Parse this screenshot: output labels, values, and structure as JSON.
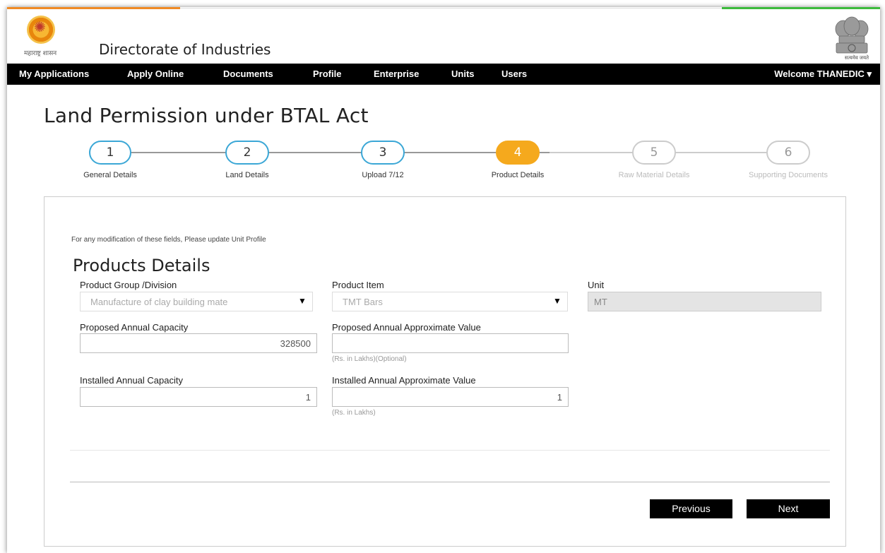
{
  "header": {
    "logo_left_text": "महाराष्ट्र शासन",
    "title": "Directorate of Industries",
    "emblem_text": "सत्यमेव जयते"
  },
  "nav": {
    "items": [
      {
        "label": "My Applications"
      },
      {
        "label": "Apply Online"
      },
      {
        "label": "Documents"
      },
      {
        "label": "Profile"
      },
      {
        "label": "Enterprise"
      },
      {
        "label": "Units"
      },
      {
        "label": "Users"
      }
    ],
    "welcome": "Welcome THANEDIC ▾"
  },
  "page": {
    "title": "Land Permission under BTAL Act"
  },
  "steps": [
    {
      "number": "1",
      "label": "General Details",
      "state": "done"
    },
    {
      "number": "2",
      "label": "Land Details",
      "state": "done"
    },
    {
      "number": "3",
      "label": "Upload 7/12",
      "state": "done"
    },
    {
      "number": "4",
      "label": "Product Details",
      "state": "active"
    },
    {
      "number": "5",
      "label": "Raw Material Details",
      "state": "future"
    },
    {
      "number": "6",
      "label": "Supporting Documents",
      "state": "future"
    }
  ],
  "form": {
    "note": "For any modification of these fields, Please update Unit Profile",
    "section_title": "Products Details",
    "product_group": {
      "label": "Product Group /Division",
      "value": "Manufacture of clay building mate"
    },
    "product_item": {
      "label": "Product Item",
      "value": "TMT Bars"
    },
    "unit": {
      "label": "Unit",
      "value": "MT"
    },
    "proposed_capacity": {
      "label": "Proposed Annual Capacity",
      "value": "328500"
    },
    "proposed_value": {
      "label": "Proposed Annual Approximate Value",
      "value": "",
      "hint": "(Rs. in Lakhs)(Optional)"
    },
    "installed_capacity": {
      "label": "Installed Annual Capacity",
      "value": "1"
    },
    "installed_value": {
      "label": "Installed Annual Approximate Value",
      "value": "1",
      "hint": "(Rs. in Lakhs)"
    }
  },
  "buttons": {
    "previous": "Previous",
    "next": "Next"
  },
  "colors": {
    "nav_bg": "#000000",
    "step_done_border": "#3ba7d6",
    "step_active": "#f5a91d",
    "step_future": "#cccccc",
    "accent_orange": "#f08a24",
    "accent_green": "#3dbb3d"
  }
}
